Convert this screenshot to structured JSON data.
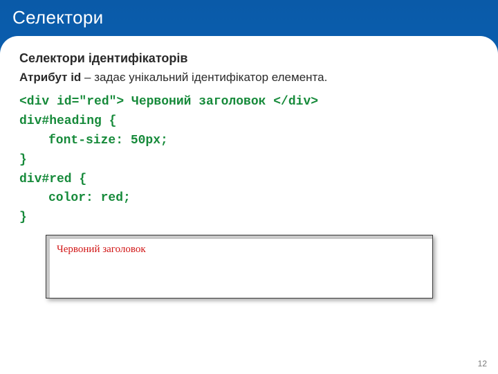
{
  "header": {
    "title": "Селектори"
  },
  "content": {
    "subtitle": "Селектори ідентифікаторів",
    "desc_bold_prefix": "Атрибут id",
    "desc_rest": " – задає унікальний ідентифікатор елемента.",
    "code": {
      "l1": "<div id=\"red\"> Червоний заголовок </div>",
      "l2": "div#heading {",
      "l3": "font-size: 50px;",
      "l4": "}",
      "l5": "div#red {",
      "l6": "color: red;",
      "l7": "}"
    },
    "example_text": "Червоний заголовок"
  },
  "page_number": "12"
}
